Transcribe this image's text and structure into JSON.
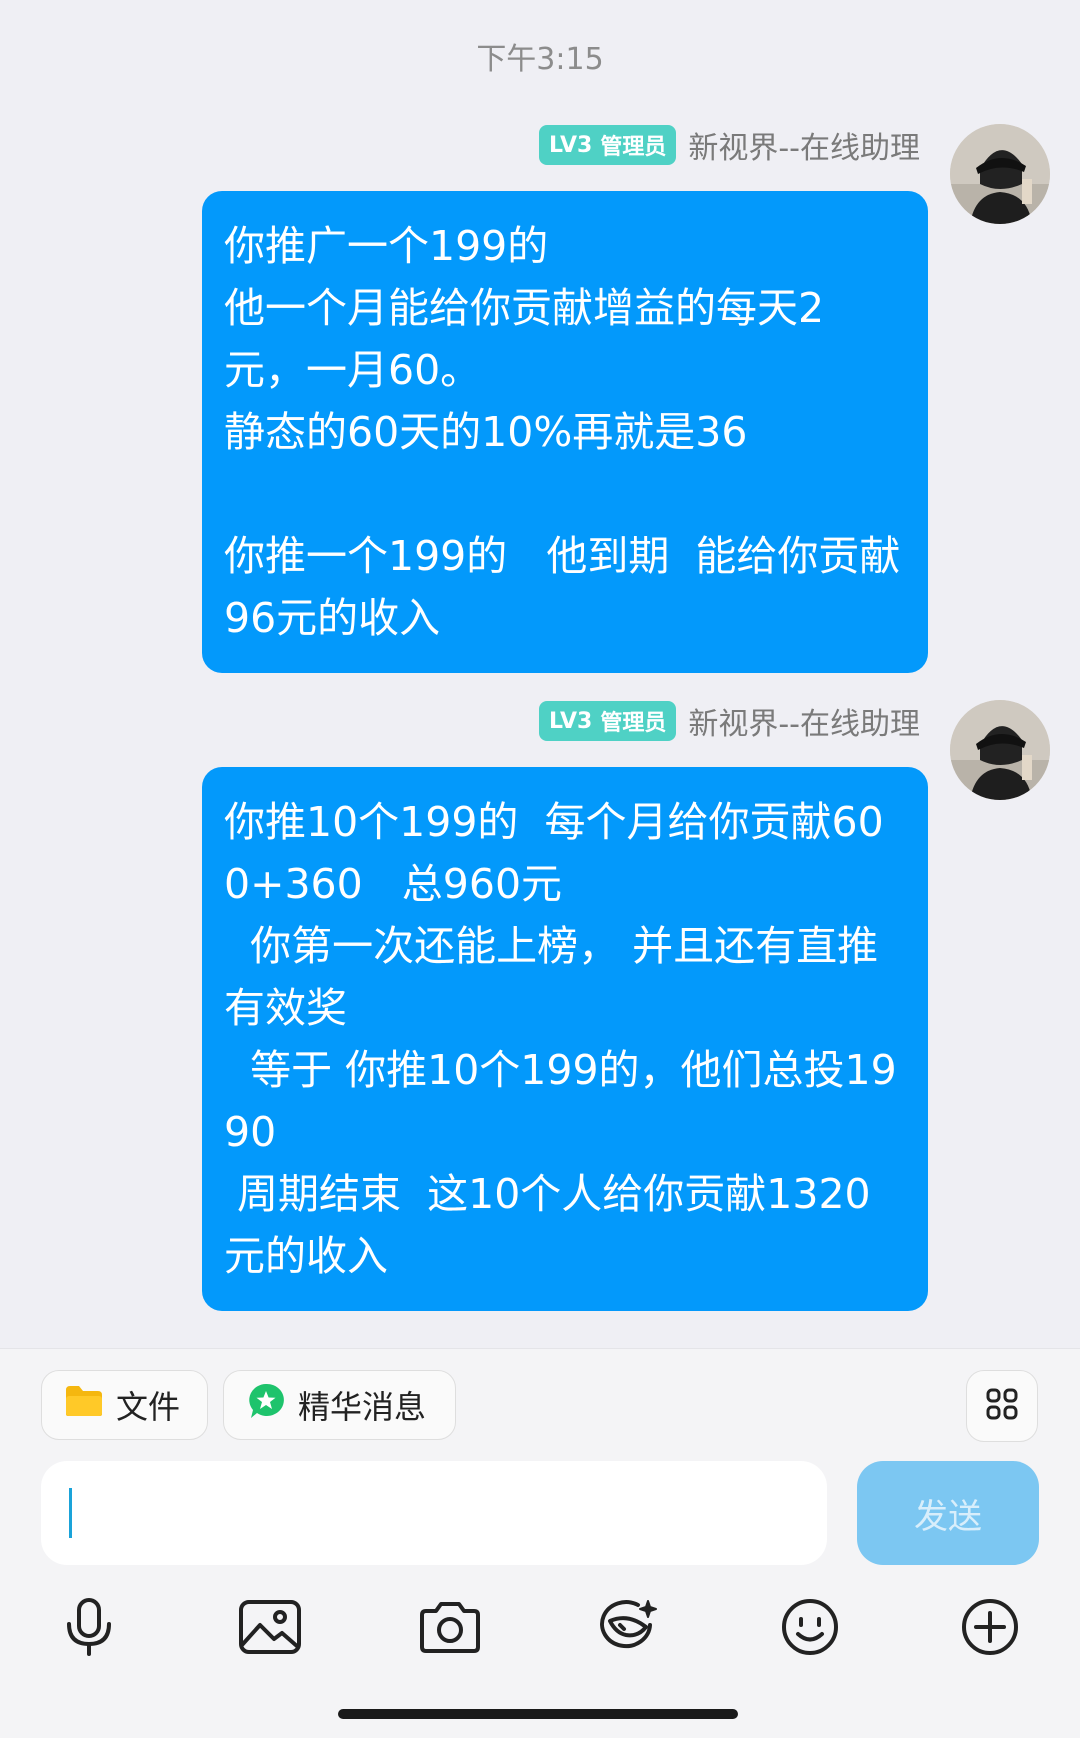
{
  "timestamp": "下午3:15",
  "messages": [
    {
      "badge_level": "LV3",
      "badge_role": "管理员",
      "sender": "新视界--在线助理",
      "text": "你推广一个199的\n他一个月能给你贡献增益的每天2元，一月60。\n静态的60天的10%再就是36\n\n你推一个199的   他到期  能给你贡献96元的收入"
    },
    {
      "badge_level": "LV3",
      "badge_role": "管理员",
      "sender": "新视界--在线助理",
      "text": "你推10个199的  每个月给你贡献600+360   总960元\n  你第一次还能上榜， 并且还有直推有效奖\n  等于 你推10个199的，他们总投1990\n 周期结束  这10个人给你贡献1320元的收入"
    }
  ],
  "chips": {
    "file_label": "文件",
    "highlights_label": "精华消息"
  },
  "input": {
    "value": ""
  },
  "send_label": "发送",
  "colors": {
    "bubble": "#0399fb",
    "badge": "#4fd1c5",
    "send_disabled": "#7cc7f2"
  },
  "toolbar_icons": [
    "microphone-icon",
    "image-icon",
    "camera-icon",
    "sticker-icon",
    "emoji-icon",
    "plus-icon"
  ]
}
